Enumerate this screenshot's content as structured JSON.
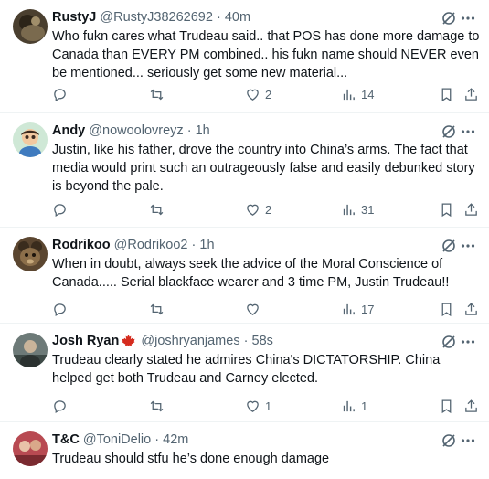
{
  "tweets": [
    {
      "name": "RustyJ",
      "handle": "@RustyJ38262692",
      "dot": "·",
      "time": "40m",
      "text": "Who fukn cares what Trudeau said.. that POS has done more damage to Canada than EVERY PM combined.. his fukn name should NEVER even be mentioned... seriously get some new material...",
      "likes": "2",
      "views": "14"
    },
    {
      "name": "Andy",
      "handle": "@nowoolovreyz",
      "dot": "·",
      "time": "1h",
      "text": "Justin, like his father, drove the country into China’s arms.  The fact that media would print such an outrageously false and easily debunked story is beyond the pale.",
      "likes": "2",
      "views": "31"
    },
    {
      "name": "Rodrikoo",
      "handle": "@Rodrikoo2",
      "dot": "·",
      "time": "1h",
      "text": "When in doubt, always seek the advice of the Moral Conscience of Canada..... Serial blackface wearer and 3 time PM, Justin Trudeau!!",
      "likes": "",
      "views": "17"
    },
    {
      "name": "Josh Ryan",
      "handle": "@joshryanjames",
      "dot": "·",
      "time": "58s",
      "text": "Trudeau clearly stated he admires China's DICTATORSHIP.  China helped get both Trudeau and Carney elected.",
      "likes": "1",
      "views": "1"
    },
    {
      "name": "T&C",
      "handle": "@ToniDelio",
      "dot": "·",
      "time": "42m",
      "text": "Trudeau should stfu  he’s done enough damage",
      "likes": "",
      "views": ""
    }
  ],
  "colors": {
    "text": "#0f1419",
    "muted": "#536471",
    "divider": "#eff3f4",
    "flag": "#d52b1e"
  },
  "icons": [
    "grok-icon",
    "more-icon",
    "reply-icon",
    "retweet-icon",
    "like-icon",
    "views-icon",
    "bookmark-icon",
    "share-icon",
    "canada-flag-icon"
  ]
}
